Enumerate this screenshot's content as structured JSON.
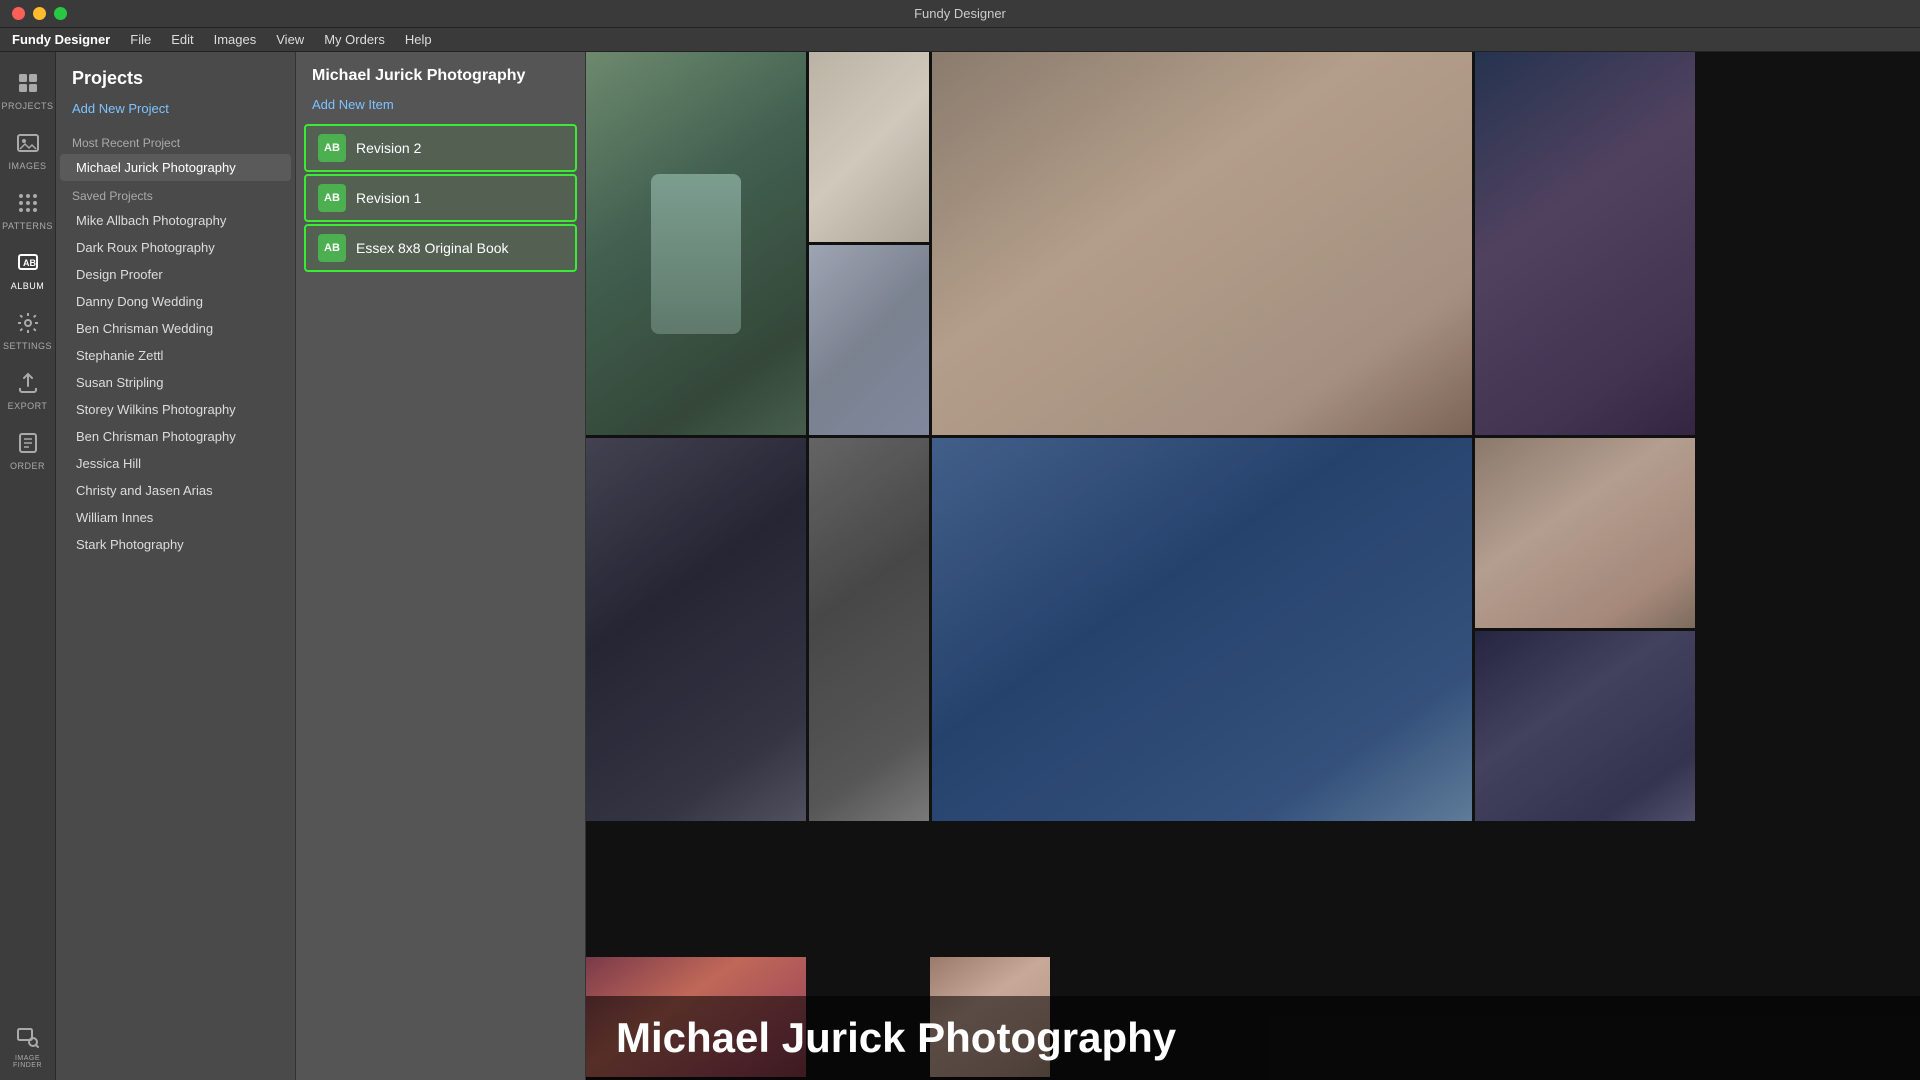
{
  "titleBar": {
    "title": "Fundy Designer"
  },
  "menuBar": {
    "appName": "Fundy Designer",
    "items": [
      "File",
      "Edit",
      "Images",
      "View",
      "My Orders",
      "Help"
    ]
  },
  "iconSidebar": {
    "items": [
      {
        "id": "projects",
        "label": "PROJECTS",
        "active": false
      },
      {
        "id": "images",
        "label": "IMAGES",
        "active": false
      },
      {
        "id": "patterns",
        "label": "PATTERNS",
        "active": false
      },
      {
        "id": "album",
        "label": "ALBUM",
        "active": true
      },
      {
        "id": "settings",
        "label": "SETTINGS",
        "active": false
      },
      {
        "id": "export",
        "label": "EXPORT",
        "active": false
      },
      {
        "id": "order",
        "label": "ORDER",
        "active": false
      },
      {
        "id": "image-finder",
        "label": "IMAGE FINDER",
        "active": false
      }
    ]
  },
  "projectsPanel": {
    "title": "Projects",
    "addNewLabel": "Add New Project",
    "mostRecentLabel": "Most Recent Project",
    "mostRecentItem": "Michael Jurick Photography",
    "savedProjectsLabel": "Saved Projects",
    "savedProjects": [
      "Mike Allbach Photography",
      "Dark Roux Photography",
      "Design Proofer",
      "Danny Dong Wedding",
      "Ben Chrisman Wedding",
      "Stephanie Zettl",
      "Susan Stripling",
      "Storey Wilkins Photography",
      "Ben Chrisman Photography",
      "Jessica Hill",
      "Christy and Jasen Arias",
      "William Innes",
      "Stark Photography"
    ]
  },
  "detailPanel": {
    "title": "Michael Jurick Photography",
    "addNewLabel": "Add New Item",
    "items": [
      {
        "id": "revision2",
        "label": "Revision 2",
        "iconText": "AB"
      },
      {
        "id": "revision1",
        "label": "Revision 1",
        "iconText": "AB"
      },
      {
        "id": "essexbook",
        "label": "Essex 8x8 Original Book",
        "iconText": "AB"
      }
    ]
  },
  "mainContent": {
    "projectName": "Michael Jurick Photography",
    "colors": {
      "accent": "#3aeb34"
    }
  }
}
